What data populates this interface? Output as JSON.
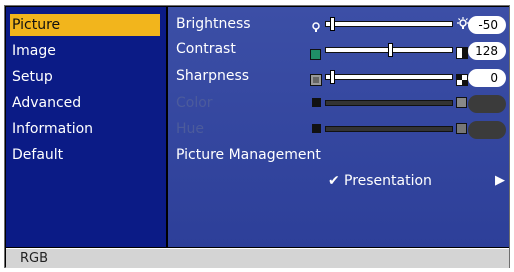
{
  "sidebar": {
    "items": [
      {
        "label": "Picture"
      },
      {
        "label": "Image"
      },
      {
        "label": "Setup"
      },
      {
        "label": "Advanced"
      },
      {
        "label": "Information"
      },
      {
        "label": "Default"
      }
    ]
  },
  "settings": {
    "brightness": {
      "label": "Brightness",
      "value": "-50"
    },
    "contrast": {
      "label": "Contrast",
      "value": "128"
    },
    "sharpness": {
      "label": "Sharpness",
      "value": "0"
    },
    "color": {
      "label": "Color"
    },
    "hue": {
      "label": "Hue"
    },
    "picture_management": {
      "label": "Picture Management",
      "selected": "Presentation",
      "check": "✔",
      "arrow": "▶"
    }
  },
  "footer": {
    "source": "RGB"
  },
  "colors": {
    "active": "#f2b51c",
    "sidebar": "#0b1b86",
    "main": "#2d3f99"
  }
}
